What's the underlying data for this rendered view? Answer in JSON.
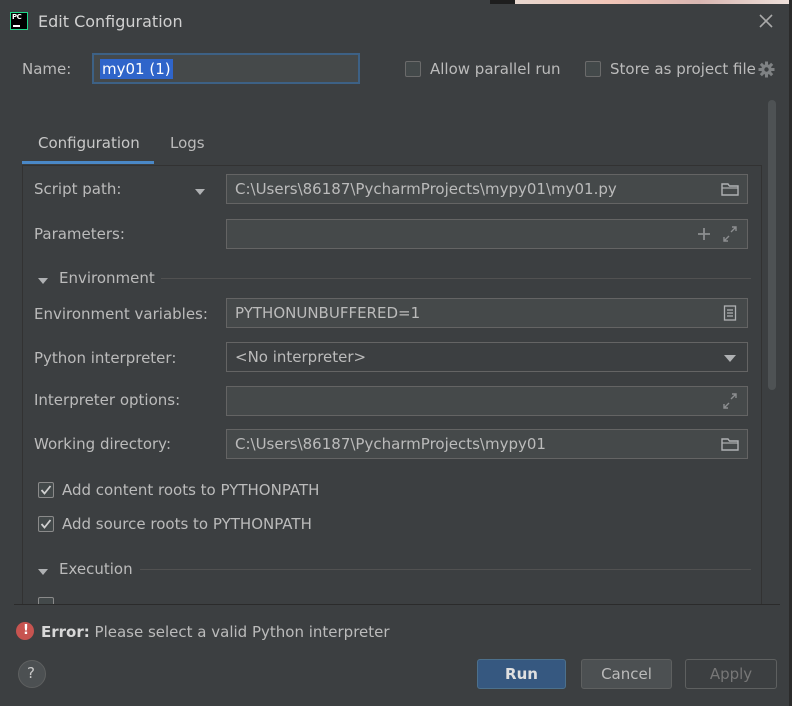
{
  "window": {
    "title": "Edit Configuration",
    "icon_text": "PC"
  },
  "name_row": {
    "label": "Name:",
    "value": "my01 (1)",
    "allow_parallel_label": "Allow parallel run",
    "store_project_label": "Store as project file"
  },
  "tabs": [
    {
      "label": "Configuration",
      "active": true
    },
    {
      "label": "Logs",
      "active": false
    }
  ],
  "config": {
    "script_path_label": "Script path:",
    "script_path_value": "C:\\Users\\86187\\PycharmProjects\\mypy01\\my01.py",
    "parameters_label": "Parameters:",
    "parameters_value": "",
    "environment_header": "Environment",
    "env_vars_label": "Environment variables:",
    "env_vars_value": "PYTHONUNBUFFERED=1",
    "interpreter_label": "Python interpreter:",
    "interpreter_value": "<No interpreter>",
    "interp_options_label": "Interpreter options:",
    "interp_options_value": "",
    "working_dir_label": "Working directory:",
    "working_dir_value": "C:\\Users\\86187\\PycharmProjects\\mypy01",
    "content_roots_label": "Add content roots to PYTHONPATH",
    "source_roots_label": "Add source roots to PYTHONPATH",
    "execution_header": "Execution"
  },
  "error": {
    "prefix": "Error:",
    "message": "Please select a valid Python interpreter"
  },
  "buttons": {
    "help": "?",
    "run": "Run",
    "cancel": "Cancel",
    "apply": "Apply"
  },
  "colors": {
    "background": "#3c3f41",
    "accent": "#4a88c7",
    "primary_button": "#365880",
    "error": "#c75450"
  }
}
